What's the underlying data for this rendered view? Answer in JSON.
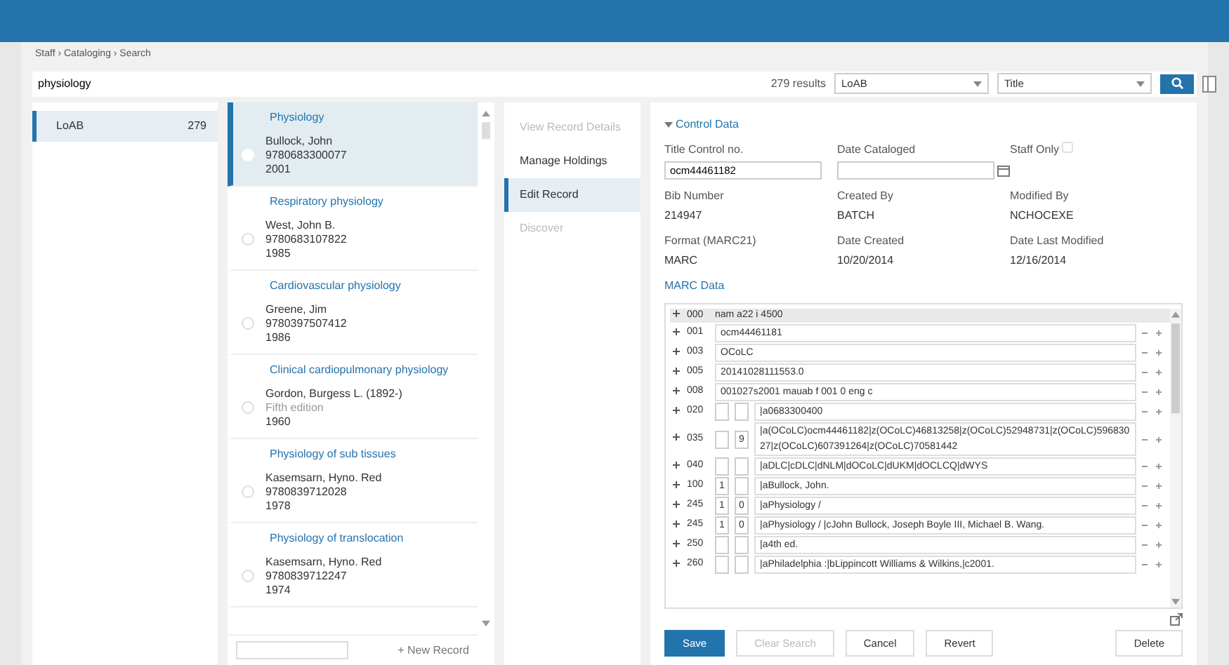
{
  "breadcrumb": "Staff › Cataloging › Search",
  "search": {
    "value": "physiology",
    "results": "279 results",
    "library": "LoAB",
    "field": "Title"
  },
  "facets": [
    {
      "label": "LoAB",
      "count": "279",
      "selected": true
    }
  ],
  "results": [
    {
      "heading": "Physiology",
      "lines": [
        "Bullock, John",
        "9780683300077",
        "2001"
      ],
      "selected": true
    },
    {
      "heading": "Respiratory physiology",
      "lines": [
        "West, John B.",
        "9780683107822",
        "1985"
      ],
      "selected": false
    },
    {
      "heading": "Cardiovascular physiology",
      "lines": [
        "Greene, Jim",
        "9780397507412",
        "1986"
      ],
      "selected": false
    },
    {
      "heading": "Clinical cardiopulmonary physiology",
      "lines": [
        "Gordon, Burgess L. (1892-)",
        "Fifth edition",
        "1960"
      ],
      "selected": false
    },
    {
      "heading": "Physiology of sub tissues",
      "lines": [
        "Kasemsarn, Hyno. Red",
        "9780839712028",
        "1978"
      ],
      "selected": false
    },
    {
      "heading": "Physiology of translocation",
      "lines": [
        "Kasemsarn, Hyno. Red",
        "9780839712247",
        "1974"
      ],
      "selected": false
    }
  ],
  "new_record": "+ New Record",
  "actions": [
    {
      "label": "View Record Details",
      "selected": false,
      "disabled": true
    },
    {
      "label": "Manage Holdings",
      "selected": false,
      "disabled": false
    },
    {
      "label": "Edit Record",
      "selected": true,
      "disabled": false
    },
    {
      "label": "Discover",
      "selected": false,
      "disabled": true
    }
  ],
  "control_data": {
    "title": "Control Data",
    "expanded": true,
    "title_control_label": "Title Control no.",
    "title_control_value": "ocm44461182",
    "date_cataloged_label": "Date Cataloged",
    "staff_only_label": "Staff Only",
    "staff_only_checked": false,
    "info": [
      {
        "label": "Bib Number",
        "value": "214947"
      },
      {
        "label": "Created By",
        "value": "BATCH"
      },
      {
        "label": "Modified By",
        "value": "NCHOCEXE"
      },
      {
        "label": "Format (MARC21)",
        "value": "MARC"
      },
      {
        "label": "Date Created",
        "value": "10/20/2014"
      },
      {
        "label": "Date Last Modified",
        "value": "12/16/2014"
      }
    ]
  },
  "marc": {
    "title": "MARC Data",
    "rows": [
      {
        "kind": "leader",
        "tag": "000",
        "value": "nam a22    i 4500"
      },
      {
        "kind": "control",
        "tag": "001",
        "value": "ocm44461181"
      },
      {
        "kind": "control",
        "tag": "003",
        "value": "OCoLC"
      },
      {
        "kind": "control",
        "tag": "005",
        "value": "20141028111553.0"
      },
      {
        "kind": "control",
        "tag": "008",
        "value": "001027s2001   mauab   f 001 0 eng c"
      },
      {
        "kind": "data",
        "tag": "020",
        "ind1": "",
        "ind2": "",
        "value": "|a0683300400"
      },
      {
        "kind": "data",
        "tag": "035",
        "ind1": "",
        "ind2": "9",
        "value": "|a(OCoLC)ocm44461182|z(OCoLC)46813258|z(OCoLC)52948731|z(OCoLC)59683027|z(OCoLC)607391264|z(OCoLC)70581442"
      },
      {
        "kind": "data",
        "tag": "040",
        "ind1": "",
        "ind2": "",
        "value": "|aDLC|cDLC|dNLM|dOCoLC|dUKM|dOCLCQ|dWYS"
      },
      {
        "kind": "data",
        "tag": "100",
        "ind1": "1",
        "ind2": "",
        "value": "|aBullock, John."
      },
      {
        "kind": "data",
        "tag": "245",
        "ind1": "1",
        "ind2": "0",
        "value": "|aPhysiology /"
      },
      {
        "kind": "data",
        "tag": "245",
        "ind1": "1",
        "ind2": "0",
        "value": "|aPhysiology / |cJohn Bullock, Joseph Boyle III, Michael B. Wang."
      },
      {
        "kind": "data",
        "tag": "250",
        "ind1": "",
        "ind2": "",
        "value": "|a4th ed."
      },
      {
        "kind": "data",
        "tag": "260",
        "ind1": "",
        "ind2": "",
        "value": "|aPhiladelphia :|bLippincott Williams & Wilkins,|c2001."
      }
    ]
  },
  "buttons": [
    {
      "label": "Save",
      "kind": "primary",
      "disabled": false
    },
    {
      "label": "Clear Search",
      "kind": "plain",
      "disabled": true
    },
    {
      "label": "Cancel",
      "kind": "plain",
      "disabled": false
    },
    {
      "label": "Revert",
      "kind": "plain",
      "disabled": false
    },
    {
      "label": "Delete",
      "kind": "end",
      "disabled": false
    }
  ]
}
